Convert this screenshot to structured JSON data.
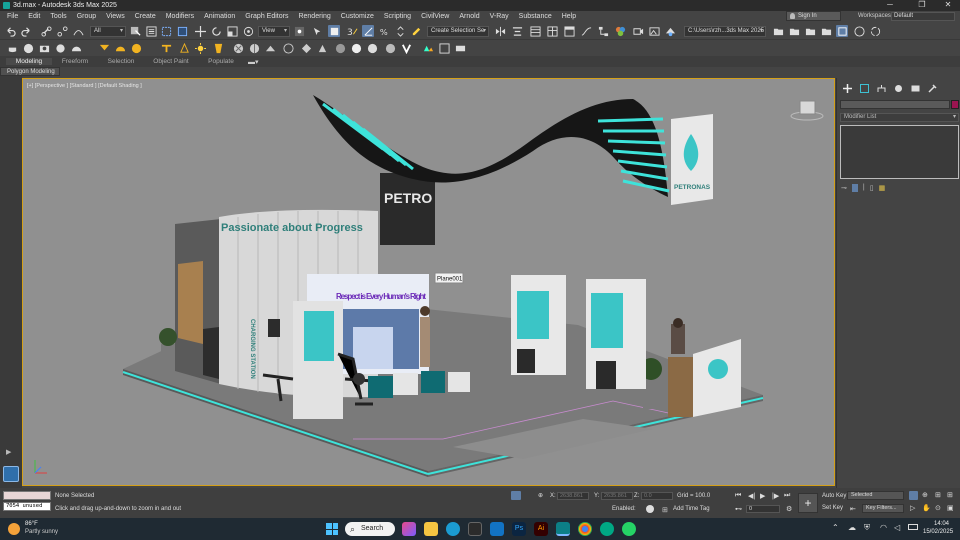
{
  "window": {
    "title": "3d.max - Autodesk 3ds Max 2025",
    "minimize": "─",
    "maximize": "❐",
    "close": "✕"
  },
  "menu": [
    "File",
    "Edit",
    "Tools",
    "Group",
    "Views",
    "Create",
    "Modifiers",
    "Animation",
    "Graph Editors",
    "Rendering",
    "Customize",
    "Scripting",
    "CivilView",
    "Arnold",
    "V-Ray",
    "Substance",
    "Help"
  ],
  "account": {
    "sign_in": "Sign In",
    "workspaces_label": "Workspaces:",
    "workspace": "Default"
  },
  "toolbar": {
    "selection_filter": "All",
    "ref_coord": "View",
    "named_selection": "Create Selection Se",
    "project_path": "C:\\Users\\rzh...3ds Max 2025"
  },
  "ribbon": {
    "tabs": [
      "Modeling",
      "Freeform",
      "Selection",
      "Object Paint",
      "Populate"
    ],
    "active_tab": "Modeling",
    "panel": "Polygon Modeling"
  },
  "viewport": {
    "label": "[+] [Perspective ] [Standard ] [Default Shading ]",
    "tooltip": "Plane001",
    "booth_text": {
      "headline": "Passionate about Progress",
      "brand": "PETRONAS",
      "banner": "Respect is Every Human's Right",
      "charging": "CHARGING STATION",
      "overhead_sign": "PETRO"
    }
  },
  "command_panel": {
    "modifier_list": "Modifier List"
  },
  "status": {
    "unused": "7054 unused",
    "selection": "None Selected",
    "prompt": "Click and drag up-and-down to zoom in and out",
    "x_label": "X:",
    "x": "2638.861",
    "y_label": "Y:",
    "y": "2635.861",
    "z_label": "Z:",
    "z": "0.0",
    "grid": "Grid = 100.0",
    "enabled": "Enabled:",
    "add_time_tag": "Add Time Tag",
    "frame": "0",
    "auto_key": "Auto Key",
    "set_key": "Set Key",
    "key_mode": "Selected",
    "key_filters": "Key Filters..."
  },
  "taskbar": {
    "weather_temp": "86°F",
    "weather_desc": "Partly sunny",
    "search": "Search",
    "time": "14:04",
    "date": "15/02/2025"
  }
}
